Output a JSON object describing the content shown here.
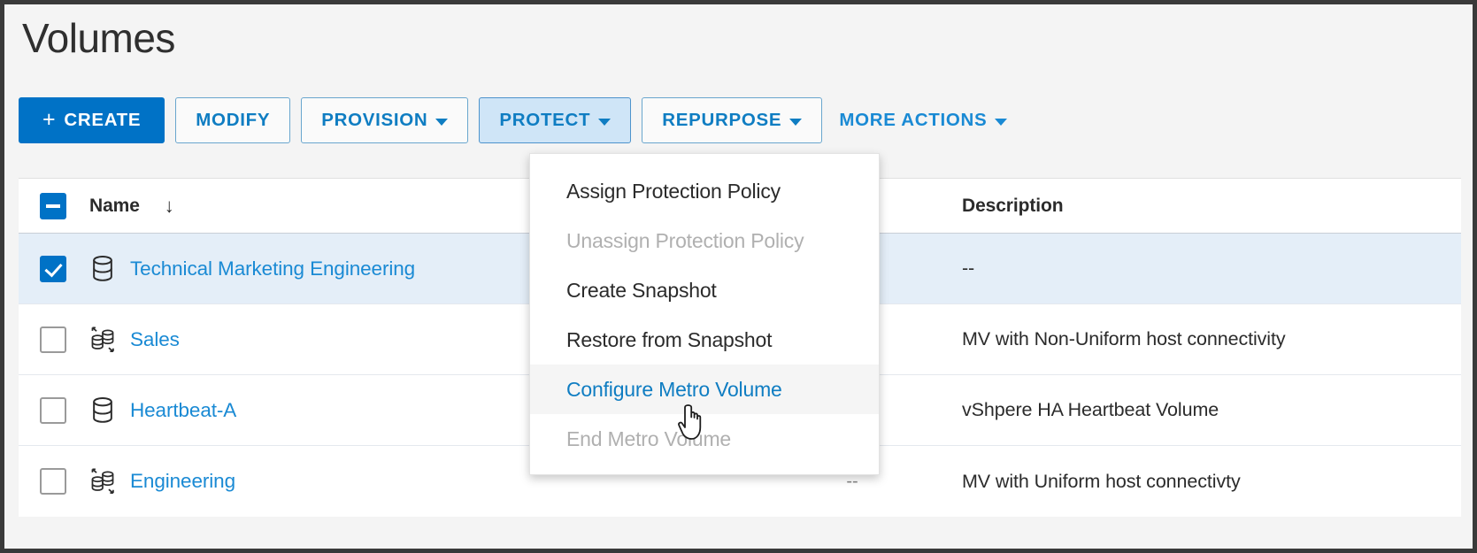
{
  "page": {
    "title": "Volumes",
    "background_color": "#f4f4f4",
    "accent_color": "#0072c6",
    "link_color": "#1a8ad4"
  },
  "toolbar": {
    "create_plus": "+",
    "create_label": "CREATE",
    "modify_label": "MODIFY",
    "provision_label": "PROVISION",
    "protect_label": "PROTECT",
    "repurpose_label": "REPURPOSE",
    "more_actions_label": "MORE ACTIONS"
  },
  "protect_menu": {
    "items": [
      {
        "label": "Assign Protection Policy",
        "state": "enabled"
      },
      {
        "label": "Unassign Protection Policy",
        "state": "disabled"
      },
      {
        "label": "Create Snapshot",
        "state": "enabled"
      },
      {
        "label": "Restore from Snapshot",
        "state": "enabled"
      },
      {
        "label": "Configure Metro Volume",
        "state": "hover"
      },
      {
        "label": "End Metro Volume",
        "state": "disabled"
      }
    ]
  },
  "table": {
    "header": {
      "select_all_state": "indeterminate",
      "name_label": "Name",
      "sort_arrow": "↓",
      "mid_label": "",
      "description_label": "Description"
    },
    "rows": [
      {
        "checked": true,
        "selected": true,
        "icon": "volume-icon",
        "name": "Technical Marketing Engineering",
        "mid": "",
        "description": "--"
      },
      {
        "checked": false,
        "selected": false,
        "icon": "metro-volume-icon",
        "name": "Sales",
        "mid": "",
        "description": "MV with Non-Uniform host connectivity"
      },
      {
        "checked": false,
        "selected": false,
        "icon": "volume-icon",
        "name": "Heartbeat-A",
        "mid": "",
        "description": "vShpere HA Heartbeat Volume"
      },
      {
        "checked": false,
        "selected": false,
        "icon": "metro-volume-icon",
        "name": "Engineering",
        "mid": "--",
        "description": "MV with Uniform host connectivty"
      }
    ]
  }
}
